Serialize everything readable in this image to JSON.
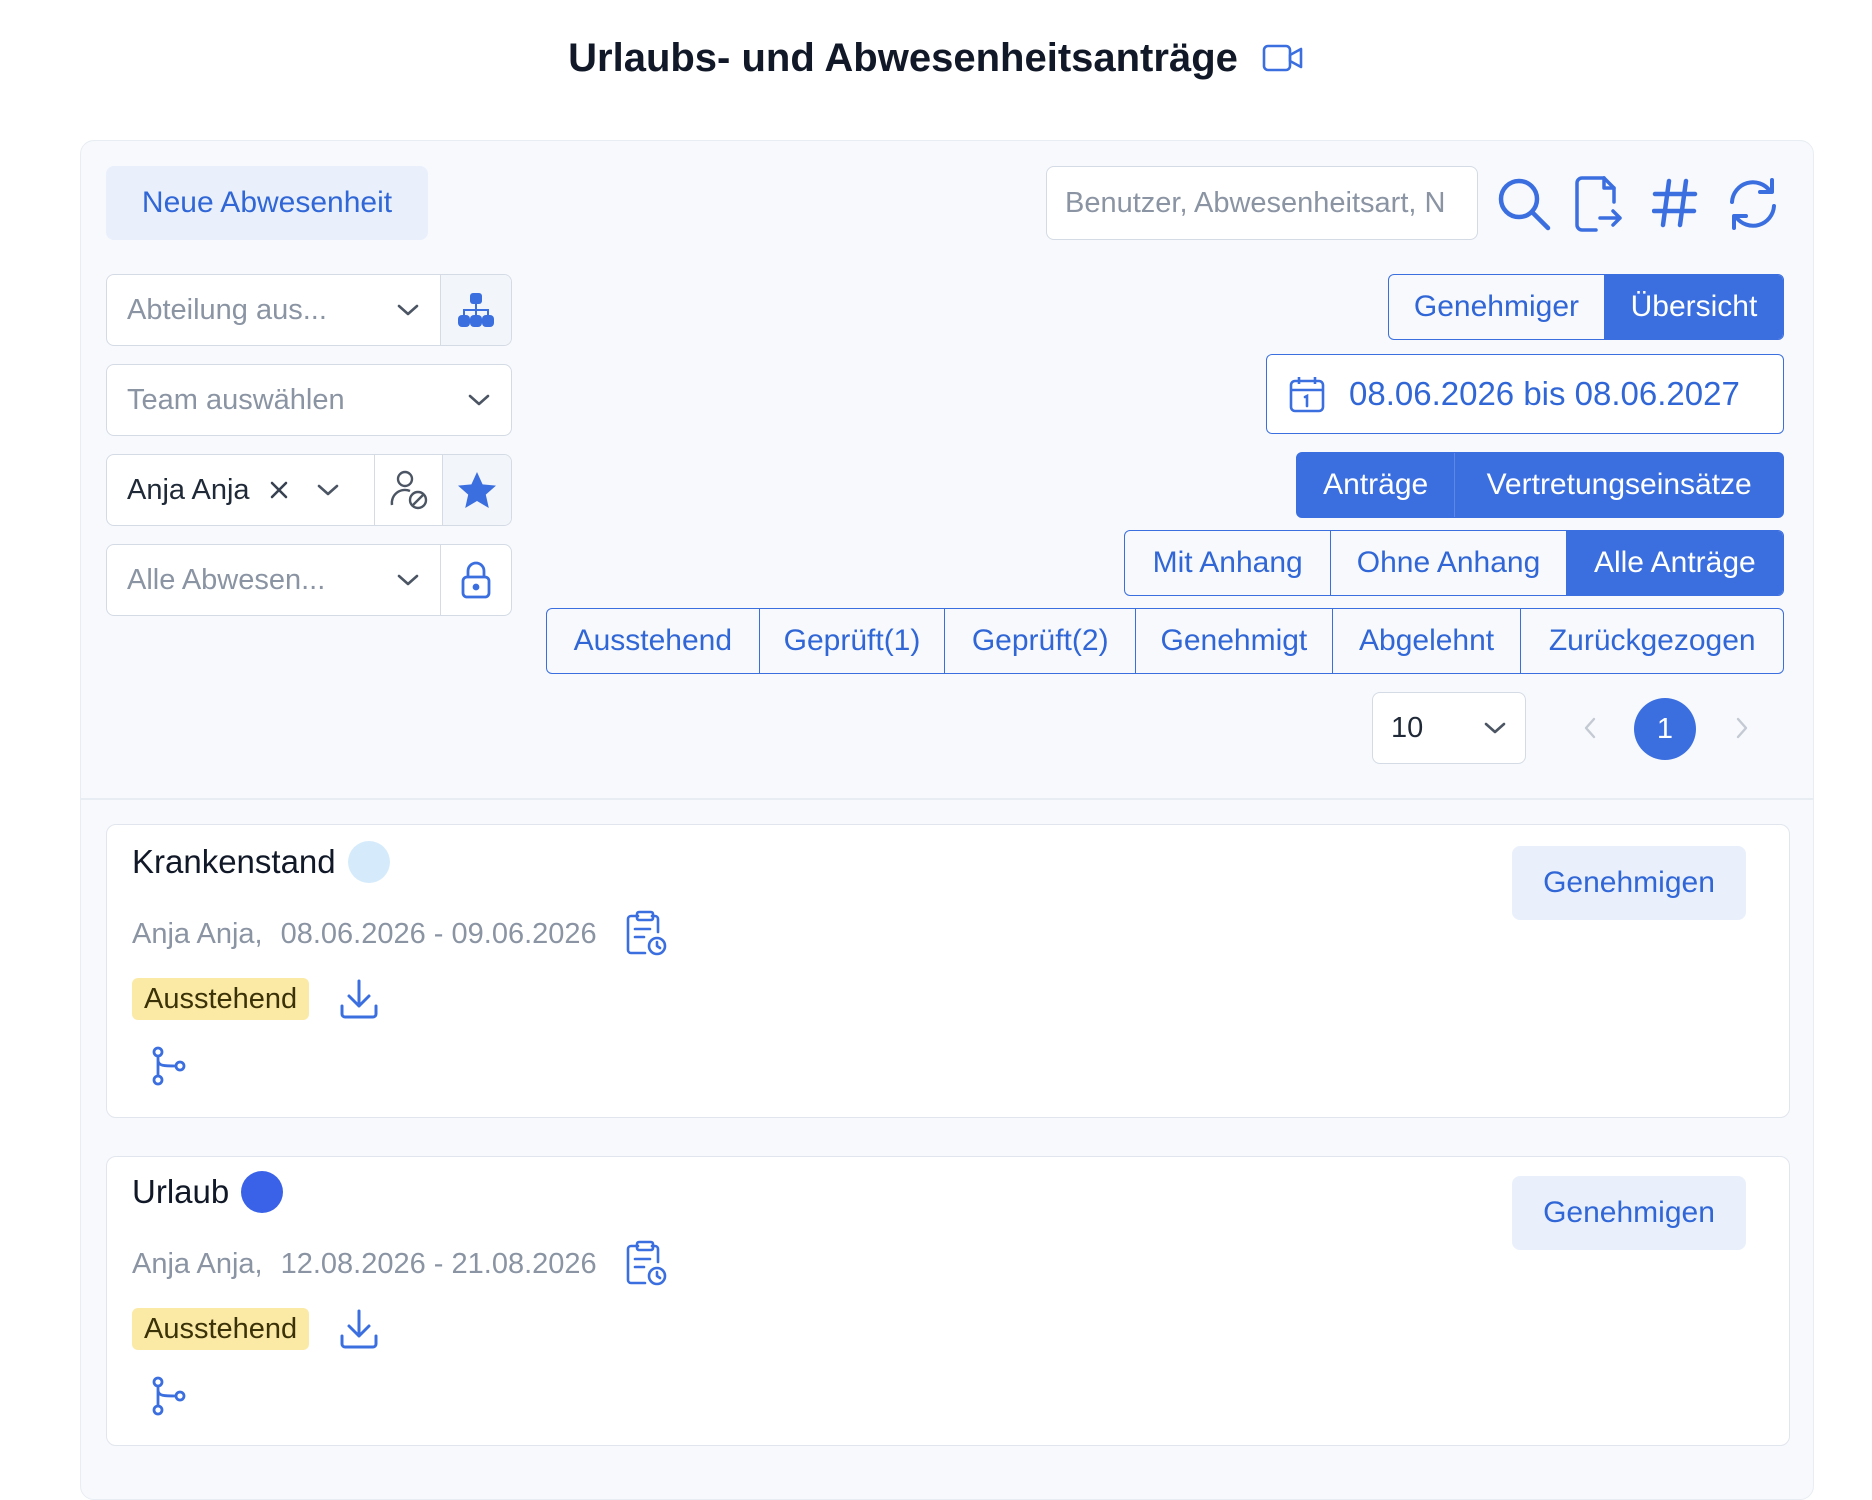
{
  "header": {
    "title": "Urlaubs- und Abwesenheitsanträge",
    "video_icon": "video-camera-icon"
  },
  "toolbar": {
    "new_absence_label": "Neue Abwesenheit",
    "search_placeholder": "Benutzer, Abwesenheitsart, N",
    "icons": [
      "search-icon",
      "file-export-icon",
      "hash-icon",
      "refresh-icon"
    ]
  },
  "filters": {
    "department_placeholder": "Abteilung aus...",
    "team_placeholder": "Team auswählen",
    "user_value": "Anja Anja",
    "absence_type_placeholder": "Alle Abwesen..."
  },
  "view_toggle": {
    "approver_label": "Genehmiger",
    "overview_label": "Übersicht",
    "active": "Übersicht"
  },
  "date_range": {
    "label": "08.06.2026 bis 08.06.2027"
  },
  "request_toggle": {
    "requests_label": "Anträge",
    "substitutions_label": "Vertretungseinsätze",
    "active": "Anträge"
  },
  "attachment_filter": {
    "with_label": "Mit Anhang",
    "without_label": "Ohne Anhang",
    "all_label": "Alle Anträge",
    "active": "Alle Anträge"
  },
  "status_filter": {
    "pending": "Ausstehend",
    "checked1": "Geprüft(1)",
    "checked2": "Geprüft(2)",
    "approved": "Genehmigt",
    "rejected": "Abgelehnt",
    "withdrawn": "Zurückgezogen"
  },
  "pagination": {
    "page_size": "10",
    "current_page": "1"
  },
  "requests": [
    {
      "type": "Krankenstand",
      "color": "#d5ebfb",
      "user": "Anja Anja,",
      "dates": "08.06.2026 - 09.06.2026",
      "status": "Ausstehend",
      "action_label": "Genehmigen"
    },
    {
      "type": "Urlaub",
      "color": "#3a62e8",
      "user": "Anja Anja,",
      "dates": "12.08.2026 - 21.08.2026",
      "status": "Ausstehend",
      "action_label": "Genehmigen"
    }
  ],
  "colors": {
    "accent": "#3b6fe0",
    "accent_text": "#3066d6",
    "pending_badge": "#fbeaa6"
  }
}
